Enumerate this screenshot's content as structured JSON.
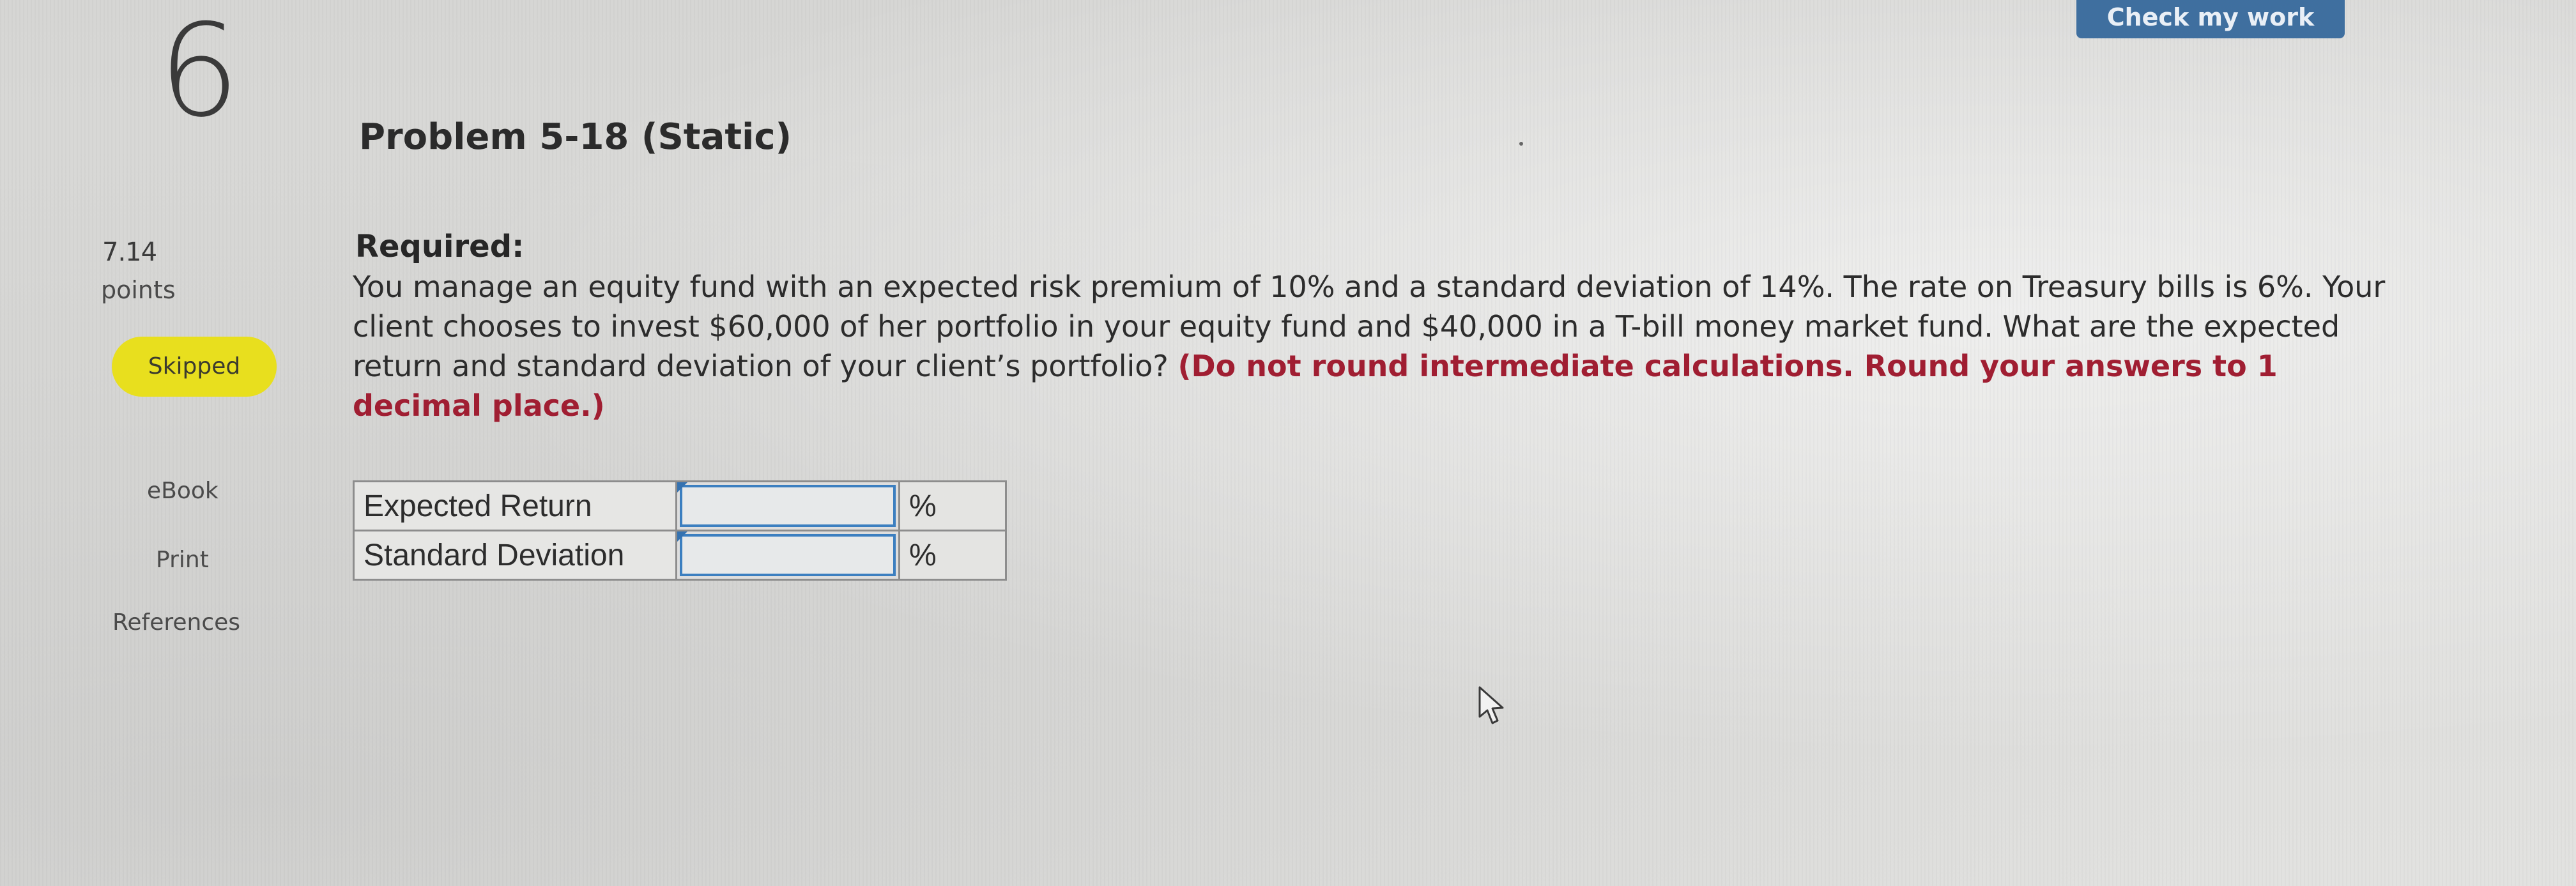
{
  "header": {
    "question_number": "6",
    "check_button_label": "Check my work"
  },
  "problem": {
    "title": "Problem 5-18 (Static)",
    "required_label": "Required:",
    "text": "You manage an equity fund with an expected risk premium of 10% and a standard deviation of 14%. The rate on Treasury bills is 6%. Your client chooses to invest $60,000 of her portfolio in your equity fund and $40,000 in a T-bill money market fund. What are the expected return and standard deviation of your client’s portfolio?",
    "instruction": "(Do not round intermediate calculations. Round your answers to 1 decimal place.)"
  },
  "sidebar": {
    "points_value": "7.14",
    "points_label": "points",
    "status_badge": "Skipped",
    "links": [
      "eBook",
      "Print",
      "References"
    ]
  },
  "answer_table": {
    "rows": [
      {
        "label": "Expected Return",
        "value": "",
        "unit": "%"
      },
      {
        "label": "Standard Deviation",
        "value": "",
        "unit": "%"
      }
    ]
  }
}
